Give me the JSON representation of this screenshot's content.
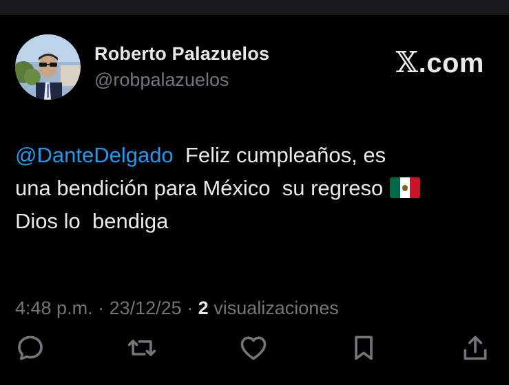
{
  "author": {
    "name": "Roberto Palazuelos",
    "handle": "@robpalazuelos"
  },
  "brand": {
    "x_glyph": "𝕏",
    "suffix": ".com"
  },
  "tweet": {
    "mention": "@DanteDelgado",
    "line1_rest": "  Feliz cumpleaños, es",
    "line2": "una bendición para México  su regreso",
    "flag_icon": "mexico-flag-icon",
    "line3": "Dios lo  bendiga"
  },
  "meta": {
    "time": "4:48 p.m.",
    "sep1": " · ",
    "date": "23/12/25",
    "sep2": " · ",
    "views_count": "2",
    "views_label": " visualizaciones"
  },
  "actions": [
    {
      "icon": "reply-icon"
    },
    {
      "icon": "retweet-icon"
    },
    {
      "icon": "like-icon"
    },
    {
      "icon": "bookmark-icon"
    },
    {
      "icon": "share-icon"
    }
  ],
  "colors": {
    "background": "#000000",
    "text": "#e7e9ea",
    "secondary": "#71767b",
    "link": "#1d9bf0"
  }
}
